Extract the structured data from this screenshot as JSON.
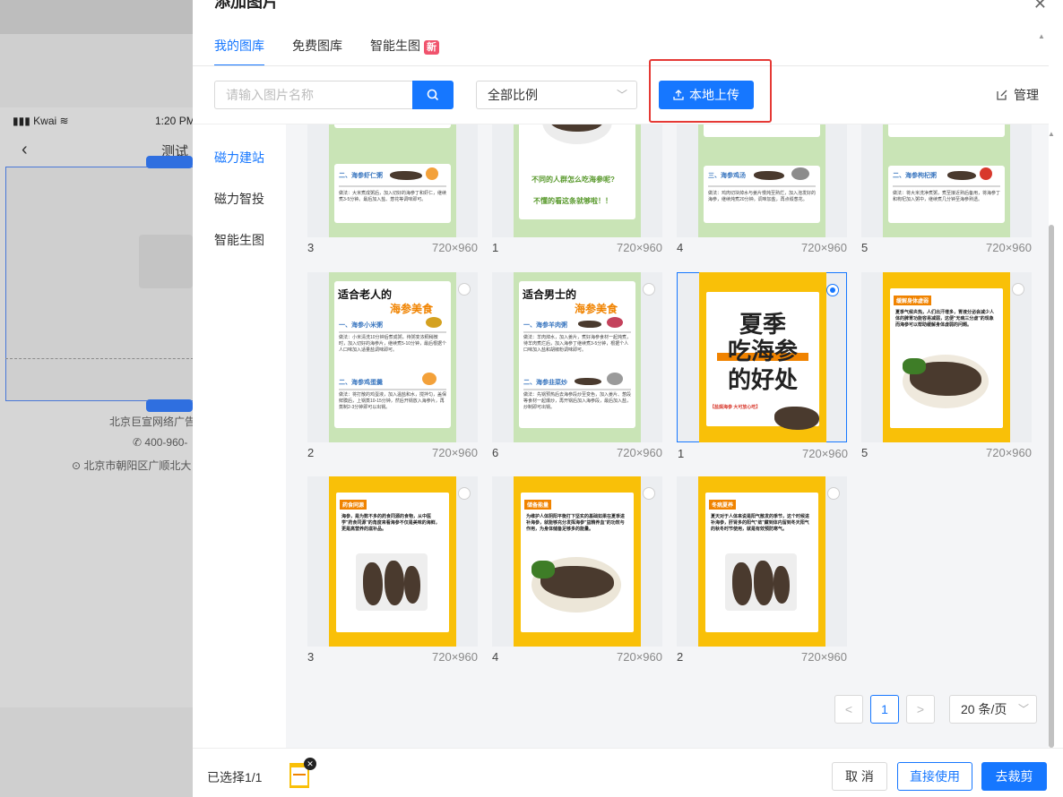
{
  "background": {
    "status_carrier": "Kwai",
    "status_time": "1:20 PM",
    "nav_back": "‹",
    "nav_title": "测试",
    "company": "北京巨宣网络广告",
    "phone": "400-960-",
    "address": "北京市朝阳区广顺北大"
  },
  "modal": {
    "title": "添加图片",
    "close": "✕",
    "tabs": [
      {
        "label": "我的图库",
        "active": true
      },
      {
        "label": "免费图库",
        "active": false
      },
      {
        "label": "智能生图",
        "active": false,
        "badge": "新"
      }
    ],
    "search": {
      "placeholder": "请输入图片名称",
      "value": ""
    },
    "ratio_select": {
      "value": "全部比例"
    },
    "upload_label": "本地上传",
    "manage_label": "管理",
    "side_nav": [
      {
        "label": "磁力建站",
        "active": true
      },
      {
        "label": "磁力智投",
        "active": false
      },
      {
        "label": "智能生图",
        "active": false
      }
    ],
    "grid": {
      "rows": [
        [
          {
            "count": "3",
            "size": "720×960"
          },
          {
            "count": "1",
            "size": "720×960"
          },
          {
            "count": "4",
            "size": "720×960"
          },
          {
            "count": "5",
            "size": "720×960"
          }
        ],
        [
          {
            "count": "2",
            "size": "720×960"
          },
          {
            "count": "6",
            "size": "720×960"
          },
          {
            "count": "1",
            "size": "720×960",
            "selected": true
          },
          {
            "count": "5",
            "size": "720×960"
          }
        ],
        [
          {
            "count": "3",
            "size": "720×960"
          },
          {
            "count": "4",
            "size": "720×960"
          },
          {
            "count": "2",
            "size": "720×960"
          }
        ]
      ],
      "thumbs": {
        "r0c0": {
          "sub": "二、海参虾仁粥"
        },
        "r0c1": {
          "line1": "不同的人群怎么吃海参呢?",
          "line2": "不懂的看这条就够啦！！"
        },
        "r0c2": {
          "sub": "三、海参鸡汤"
        },
        "r0c3": {
          "sub": "二、海参枸杞粥"
        },
        "r1c0": {
          "title1": "适合老人的",
          "title2": "海参美食",
          "sub1": "一、海参小米粥",
          "sub2": "二、海参鸡蛋羹"
        },
        "r1c1": {
          "title1": "适合男士的",
          "title2": "海参美食",
          "sub1": "一、海参羊肉粥",
          "sub2": "二、海参韭菜炒"
        },
        "r1c2": {
          "line1": "夏季",
          "line2": "吃海参",
          "line3": "的好处",
          "tag": "【盐焗海参 大可放心吃】"
        },
        "r1c3": {
          "tag": "缓解身体虚弱"
        },
        "r2c0": {
          "tag": "药食同源"
        },
        "r2c1": {
          "tag": "储备能量"
        },
        "r2c2": {
          "tag": "冬病夏养"
        }
      }
    },
    "pagination": {
      "prev": "<",
      "current": "1",
      "next": ">",
      "page_size": "20 条/页"
    },
    "footer": {
      "selected_label": "已选择1/1",
      "cancel": "取 消",
      "direct_use": "直接使用",
      "crop": "去裁剪"
    }
  }
}
